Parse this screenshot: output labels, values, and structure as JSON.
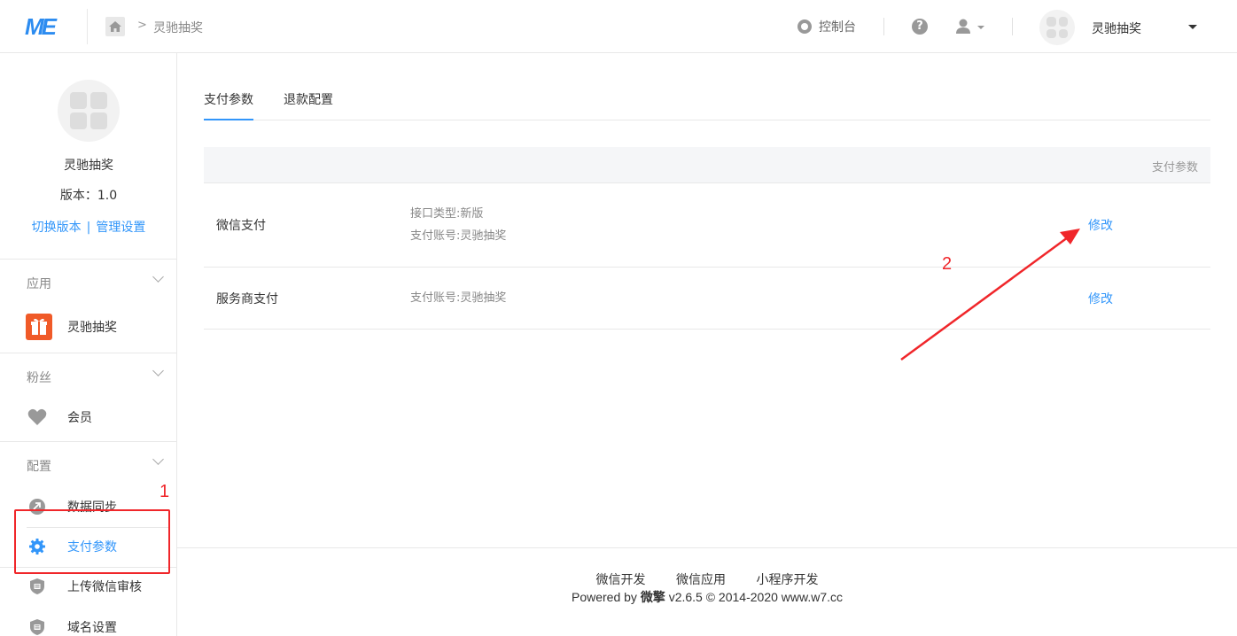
{
  "header": {
    "logo_text": "ME",
    "breadcrumb_sep": ">",
    "breadcrumb_current": "灵驰抽奖",
    "console_label": "控制台",
    "help_label": "?",
    "account_name": "灵驰抽奖",
    "icons": [
      "home-icon",
      "console-icon",
      "help-icon",
      "user-icon",
      "caret-down-icon"
    ]
  },
  "sidebar": {
    "app_name": "灵驰抽奖",
    "version": "版本：1.0",
    "switch_version": "切换版本",
    "link_sep": "|",
    "manage_settings": "管理设置",
    "groups": [
      {
        "title": "应用",
        "items": [
          {
            "label": "灵驰抽奖",
            "icon": "gift-icon"
          }
        ]
      },
      {
        "title": "粉丝",
        "items": [
          {
            "label": "会员",
            "icon": "heart-icon"
          }
        ]
      },
      {
        "title": "配置",
        "items": [
          {
            "label": "数据同步",
            "icon": "link-icon"
          },
          {
            "label": "支付参数",
            "icon": "gear-icon",
            "active": true
          },
          {
            "label": "上传微信审核",
            "icon": "shield-icon"
          },
          {
            "label": "域名设置",
            "icon": "shield-icon"
          }
        ]
      }
    ]
  },
  "tabs": [
    {
      "label": "支付参数",
      "active": true
    },
    {
      "label": "退款配置"
    }
  ],
  "table": {
    "header": "支付参数",
    "rows": [
      {
        "name": "微信支付",
        "info": [
          "接口类型:新版",
          "支付账号:灵驰抽奖"
        ],
        "action": "修改"
      },
      {
        "name": "服务商支付",
        "info": [
          "支付账号:灵驰抽奖"
        ],
        "action": "修改"
      }
    ]
  },
  "annotations": {
    "one": "1",
    "two": "2"
  },
  "footer": {
    "links": [
      "微信开发",
      "微信应用",
      "小程序开发"
    ],
    "powered_prefix": "Powered by ",
    "brand": "微擎",
    "powered_suffix": " v2.6.5 © 2014-2020 www.w7.cc"
  },
  "colors": {
    "accent": "#3296fa",
    "annotation": "#f0262a",
    "gift": "#f05a28"
  }
}
